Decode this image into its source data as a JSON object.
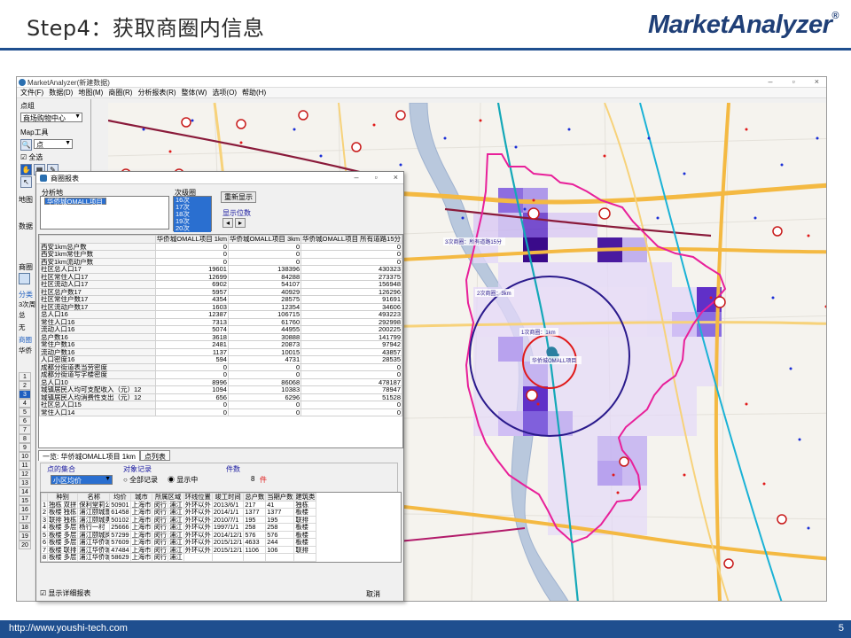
{
  "slide": {
    "title": "Step4：获取商圈内信息",
    "logo": "MarketAnalyzer",
    "logo_mark": "®",
    "footer_url": "http://www.youshi-tech.com",
    "page_number": "5"
  },
  "app": {
    "title": "MarketAnalyzer(新建数据)",
    "window_buttons": [
      "–",
      "▫",
      "×"
    ],
    "menu": [
      "文件(F)",
      "数据(D)",
      "地图(M)",
      "商圈(R)",
      "分析报表(R)",
      "整体(W)",
      "选项(O)",
      "帮助(H)"
    ]
  },
  "tools": {
    "point_group_label": "点组",
    "point_group_value": "商场购物中心",
    "map_tools_label": "Map工具",
    "map_tools_select": "点",
    "check_all": "全选",
    "side_labels": [
      "地图",
      "数据",
      "商圈",
      "分类"
    ],
    "row_numbers": [
      "1",
      "2",
      "3",
      "4",
      "5",
      "6",
      "7",
      "8",
      "9",
      "10",
      "11",
      "12",
      "13",
      "14",
      "15",
      "16",
      "17",
      "18",
      "19",
      "20"
    ],
    "side_items": [
      "3次周",
      "总",
      "无",
      "商圈",
      "华侨"
    ]
  },
  "dialog": {
    "title": "商圈报表",
    "window_buttons": [
      "–",
      "▫",
      "×"
    ],
    "analysis_label": "分析地",
    "analysis_items": [
      "华侨城OMALL项目"
    ],
    "ring_label": "次级圈",
    "ring_items": [
      "16次",
      "17次",
      "18次",
      "19次",
      "20次"
    ],
    "refresh_button": "重新显示",
    "display_pos_label": "显示位数",
    "grid_headers": [
      "",
      "华侨城OMALL项目 1km",
      "华侨城OMALL项目 3km",
      "华侨城OMALL项目 所有道路15分"
    ],
    "grid_rows": [
      [
        "西安1km总户数",
        "0",
        "0",
        "0"
      ],
      [
        "西安1km常住户数",
        "0",
        "0",
        "0"
      ],
      [
        "西安1km流动户数",
        "0",
        "0",
        "0"
      ],
      [
        "社区总人口17",
        "19601",
        "138396",
        "430323"
      ],
      [
        "社区常住人口17",
        "12699",
        "84288",
        "273375"
      ],
      [
        "社区流动人口17",
        "6902",
        "54107",
        "156948"
      ],
      [
        "社区总户数17",
        "5957",
        "40929",
        "126296"
      ],
      [
        "社区常住户数17",
        "4354",
        "28575",
        "91691"
      ],
      [
        "社区流动户数17",
        "1603",
        "12354",
        "34606"
      ],
      [
        "总人口16",
        "12387",
        "106715",
        "493223"
      ],
      [
        "常住人口16",
        "7313",
        "61760",
        "292998"
      ],
      [
        "流动人口16",
        "5074",
        "44955",
        "200225"
      ],
      [
        "总户数16",
        "3618",
        "30888",
        "141799"
      ],
      [
        "常住户数16",
        "2481",
        "20873",
        "97942"
      ],
      [
        "流动户数16",
        "1137",
        "10015",
        "43857"
      ],
      [
        "人口密度16",
        "594",
        "4731",
        "28535"
      ],
      [
        "成都分街道表当劳密度",
        "0",
        "0",
        "0"
      ],
      [
        "成都分街道写字楼密度",
        "0",
        "0",
        "0"
      ],
      [
        "总人口10",
        "8996",
        "86068",
        "478187"
      ],
      [
        "城镇居民人均可支配收入（元）12",
        "1094",
        "10383",
        "78947"
      ],
      [
        "城镇居民人均消费性支出（元）12",
        "656",
        "6296",
        "51528"
      ],
      [
        "社区总人口15",
        "0",
        "0",
        "0"
      ],
      [
        "常住人口14",
        "0",
        "0",
        "0"
      ]
    ],
    "tabs": [
      "一览: 华侨城OMALL项目 1km",
      "点列表"
    ],
    "point_set_label": "点的集合",
    "point_set_value": "小区均价",
    "target_label": "对象记录",
    "radio_all": "全部记录",
    "radio_shown": "显示中",
    "count_label": "件数",
    "count_value": "8",
    "count_unit": "件",
    "ptable_headers": [
      "",
      "种别",
      "名称",
      "均价",
      "城市",
      "所属区域",
      "环线位置",
      "竣工时间",
      "总户数",
      "当期户数",
      "建筑类"
    ],
    "ptable_rows": [
      [
        "1",
        "独栋 双拼",
        "保利堂莉公",
        "50901",
        "上海市",
        "闵行",
        "浦江",
        "外环以外",
        "2013/6/1",
        "217",
        "41",
        "独栋"
      ],
      [
        "2",
        "板楼 独栋",
        "浦江颐城蕾",
        "61458",
        "上海市",
        "闵行",
        "浦江",
        "外环以外",
        "2014/1/1",
        "1377",
        "1377",
        "板楼"
      ],
      [
        "3",
        "联排 独栋",
        "浦江颐城勇",
        "50102",
        "上海市",
        "闵行",
        "浦江",
        "外环以外",
        "2010/7/1",
        "195",
        "195",
        "联排"
      ],
      [
        "4",
        "板楼 多层",
        "杨行一村",
        "25666",
        "上海市",
        "闵行",
        "浦江",
        "外环以外",
        "1997/1/1",
        "258",
        "258",
        "板楼"
      ],
      [
        "5",
        "板楼 多层",
        "浦江颐城岗",
        "57299",
        "上海市",
        "闵行",
        "浦江",
        "外环以外",
        "2014/12/1",
        "576",
        "576",
        "板楼"
      ],
      [
        "6",
        "板楼 多层",
        "浦江华侨城",
        "57609",
        "上海市",
        "闵行",
        "浦江",
        "外环以外",
        "2015/12/1",
        "4633",
        "244",
        "板楼"
      ],
      [
        "7",
        "板楼 联排",
        "浦江华侨城",
        "47484",
        "上海市",
        "闵行",
        "浦江",
        "外环以外",
        "2015/12/1",
        "1106",
        "106",
        "联排"
      ],
      [
        "8",
        "板楼 多层",
        "浦江华侨城",
        "58629",
        "上海市",
        "闵行",
        "浦江",
        "",
        "",
        "",
        "",
        ""
      ]
    ],
    "show_detail": "显示详细报表",
    "cancel": "取消"
  },
  "map": {
    "label_15min": "3次商圈：所有道路15分",
    "label_3km": "2次商圈：3km",
    "label_1km": "1次商圈：1km",
    "label_project": "华侨城OMALL项目",
    "colors": {
      "trade_area": "#e8209a",
      "circle_3km": "#2a1a8c",
      "circle_1km": "#e01a1a",
      "heat_light": "#d9c8f4",
      "heat_dark": "#3a0a8a"
    }
  }
}
